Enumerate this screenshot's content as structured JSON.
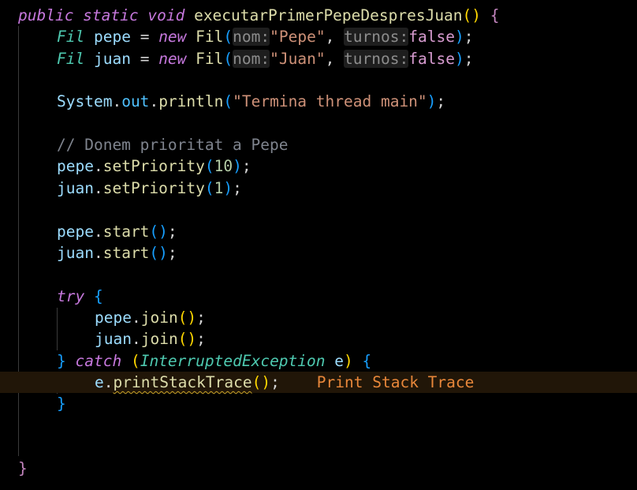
{
  "editor": {
    "method_signature": {
      "modifiers": "public static void",
      "name": "executarPrimerPepeDespresJuan"
    },
    "fil_pepe": {
      "type": "Fil",
      "var": "pepe",
      "new": "new",
      "ctor": "Fil",
      "hint_nom": "nom:",
      "arg_name": "\"Pepe\"",
      "hint_turnos": "turnos:",
      "arg_turnos": "false"
    },
    "fil_juan": {
      "type": "Fil",
      "var": "juan",
      "new": "new",
      "ctor": "Fil",
      "hint_nom": "nom:",
      "arg_name": "\"Juan\"",
      "hint_turnos": "turnos:",
      "arg_turnos": "false"
    },
    "println": {
      "system": "System",
      "out": "out",
      "method": "println",
      "arg": "\"Termina thread main\""
    },
    "comment": "// Donem prioritat a Pepe",
    "prio_pepe": {
      "var": "pepe",
      "method": "setPriority",
      "arg": "10"
    },
    "prio_juan": {
      "var": "juan",
      "method": "setPriority",
      "arg": "1"
    },
    "start_pepe": {
      "var": "pepe",
      "method": "start"
    },
    "start_juan": {
      "var": "juan",
      "method": "start"
    },
    "try_kw": "try",
    "join_pepe": {
      "var": "pepe",
      "method": "join"
    },
    "join_juan": {
      "var": "juan",
      "method": "join"
    },
    "catch": {
      "kw": "catch",
      "exception": "InterruptedException",
      "var": "e"
    },
    "print_stack": {
      "var": "e",
      "method": "printStackTrace",
      "ghost": "Print Stack Trace"
    }
  },
  "colors": {
    "background": "#000000",
    "current_line": "#211608",
    "keyword": "#c678dd",
    "type": "#4ec9b0",
    "string": "#ce9178",
    "number": "#b5cea8",
    "ghost_text": "#e8873a",
    "squiggle": "#c9a227"
  }
}
